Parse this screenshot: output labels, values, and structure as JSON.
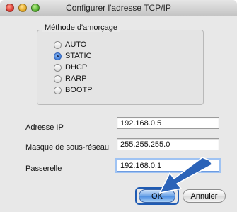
{
  "window": {
    "title": "Configurer l'adresse TCP/IP"
  },
  "boot_method": {
    "legend": "Méthode d'amorçage",
    "options": [
      {
        "label": "AUTO",
        "selected": false
      },
      {
        "label": "STATIC",
        "selected": true
      },
      {
        "label": "DHCP",
        "selected": false
      },
      {
        "label": "RARP",
        "selected": false
      },
      {
        "label": "BOOTP",
        "selected": false
      }
    ]
  },
  "fields": {
    "ip": {
      "label": "Adresse IP",
      "value": "192.168.0.5"
    },
    "subnet": {
      "label": "Masque de sous-réseau",
      "value": "255.255.255.0"
    },
    "gateway": {
      "label": "Passerelle",
      "value": "192.168.0.1"
    }
  },
  "buttons": {
    "ok": "OK",
    "cancel": "Annuler"
  },
  "colors": {
    "accent": "#1f5bb3",
    "arrow": "#2b63b8"
  }
}
